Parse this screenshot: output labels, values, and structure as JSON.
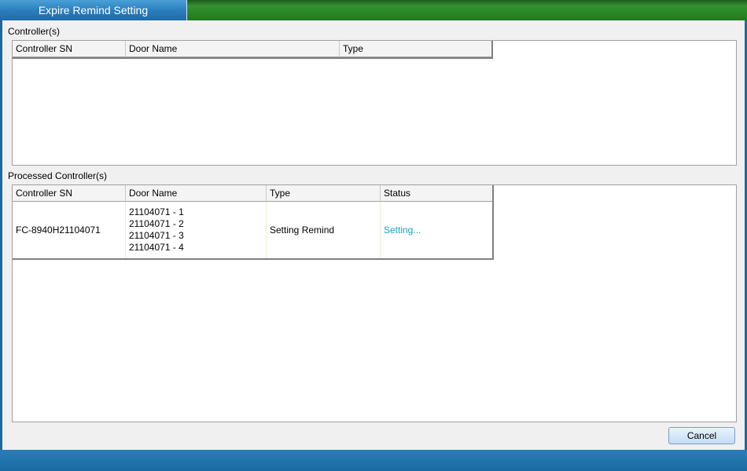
{
  "window": {
    "title": "Expire Remind Setting"
  },
  "controllers_section": {
    "label": "Controller(s)",
    "columns": [
      "Controller SN",
      "Door Name",
      "Type"
    ],
    "rows": []
  },
  "processed_section": {
    "label": "Processed Controller(s)",
    "columns": [
      "Controller SN",
      "Door Name",
      "Type",
      "Status"
    ],
    "rows": [
      {
        "controller_sn": "FC-8940H21104071",
        "doors": [
          "21104071 - 1",
          "21104071 - 2",
          "21104071 - 3",
          "21104071 - 4"
        ],
        "type": "Setting Remind",
        "status": "Setting..."
      }
    ]
  },
  "buttons": {
    "cancel": "Cancel"
  },
  "colors": {
    "title_tab": "#2b7fbe",
    "title_bar": "#2f8c2c",
    "status_text": "#1aa3c8"
  }
}
